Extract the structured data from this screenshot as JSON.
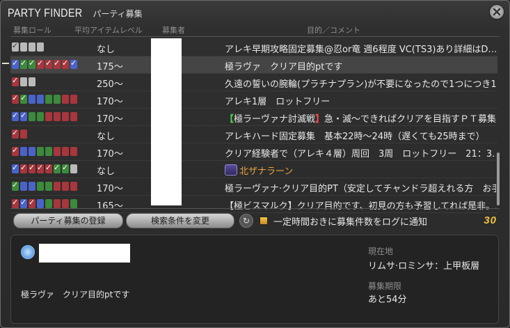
{
  "window": {
    "title_en": "PARTY FINDER",
    "title_jp": "パーティ募集"
  },
  "columns": {
    "roles": "募集ロール",
    "ilvl": "平均アイテムレベル",
    "recruiter": "募集者",
    "comment": "目的／コメント"
  },
  "rows": [
    {
      "ilvl": "なし",
      "comment": "アレキ早期攻略固定募集@忍or竜 週6程度 VC(TS3)あり詳細はD…"
    },
    {
      "ilvl": "175〜",
      "comment": "極ラヴァ　クリア目的ptです"
    },
    {
      "ilvl": "250〜",
      "comment": "久遠の誓いの腕輪(プラチナプラン)が不要になったので1つにつき1…"
    },
    {
      "ilvl": "170〜",
      "comment": "アレキ1層　ロットフリー"
    },
    {
      "ilvl": "170〜",
      "comment_parts": [
        "【",
        "極ラーヴァナ討滅戦",
        "】",
        "急・滅〜できればクリアを目指すＰＴ募集！…"
      ]
    },
    {
      "ilvl": "なし",
      "comment": "アレキハード固定募集　基本22時〜24時（遅くても25時まで）"
    },
    {
      "ilvl": "170〜",
      "comment": "クリア経験者で（アレキ４層）周回　3周　ロットフリー　21：3…"
    },
    {
      "ilvl": "なし",
      "comment": "北ザナラーン"
    },
    {
      "ilvl": "170〜",
      "comment": "極ラーヴァナ·クリア目的PT（安定してチャンドラ超えれる方　お手…"
    },
    {
      "ilvl": "165〜",
      "comment": "【極ビスマルク】クリア目的です、初見の方も予習してれば是非。…"
    }
  ],
  "buttons": {
    "register": "パーティ募集の登録",
    "change_search": "検索条件を変更",
    "refresh_icon": "refresh-icon"
  },
  "notify": {
    "label": "一定時間おきに募集件数をログに通知",
    "checked": true
  },
  "count": "30",
  "detail": {
    "comment": "極ラヴァ　クリア目的ptです",
    "location_label": "現在地",
    "location_value": "リムサ·ロミンサ：上甲板層",
    "expiry_label": "募集期限",
    "expiry_value": "あと54分"
  },
  "colors": {
    "tank": "#4a63c9",
    "healer": "#3c8a3c",
    "dps": "#a8363d",
    "any": "#b9b9b9",
    "accent": "#f2c342"
  }
}
